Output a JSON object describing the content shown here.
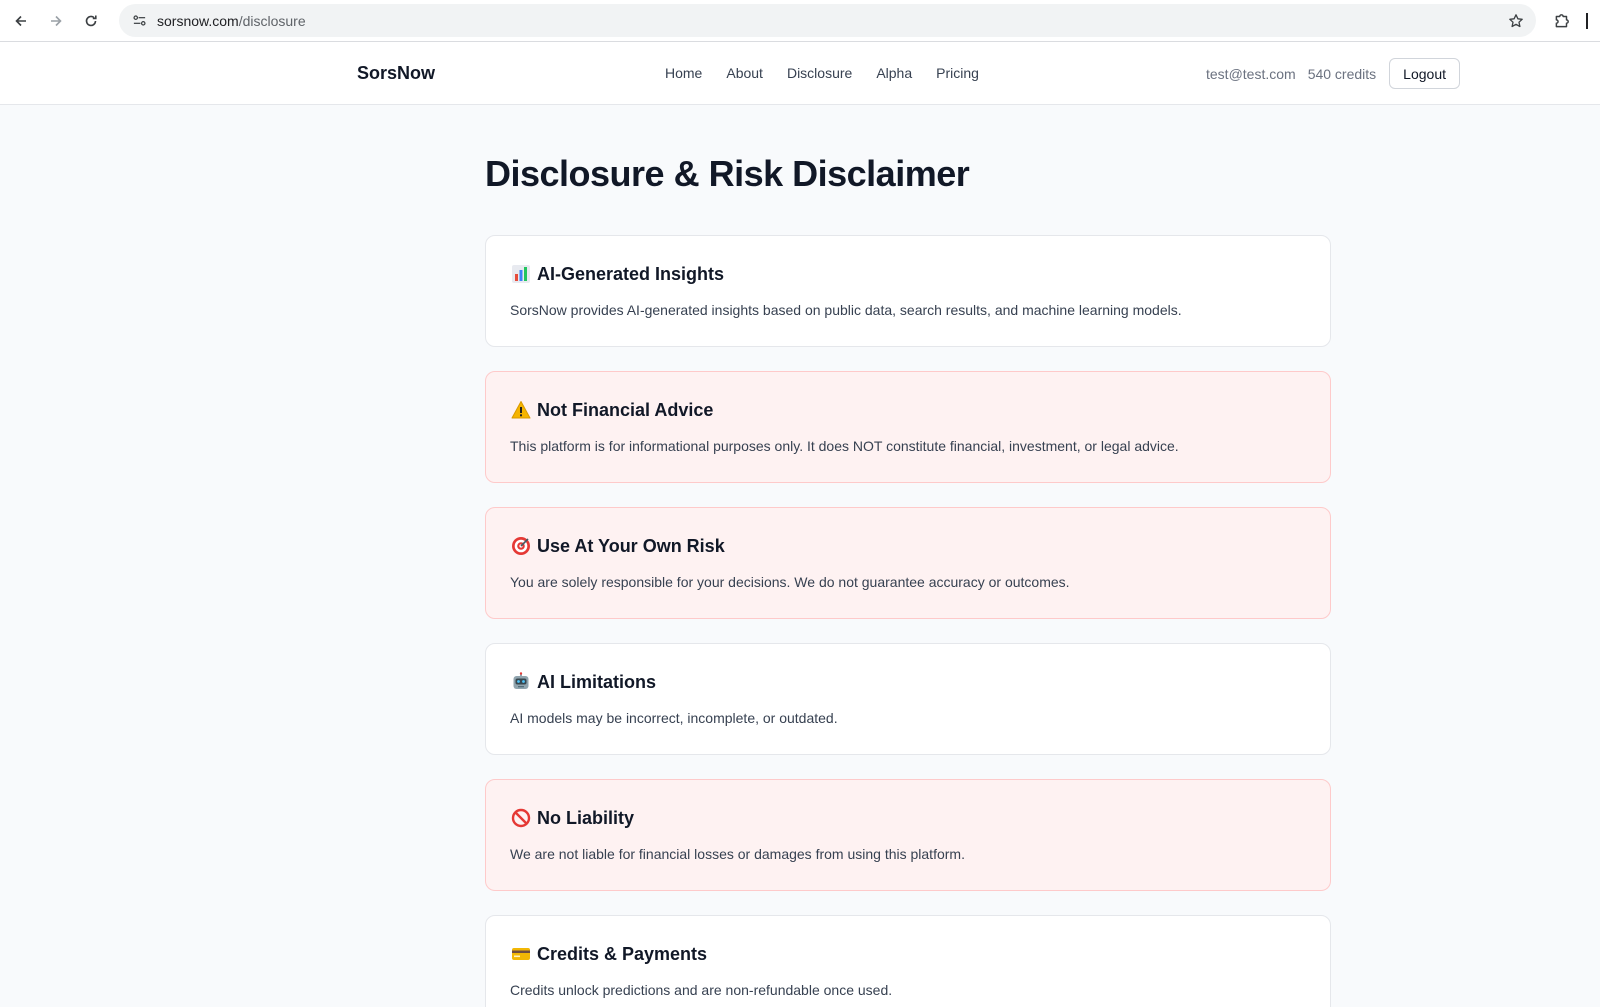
{
  "browser": {
    "url_host": "sorsnow.com",
    "url_path": "/disclosure"
  },
  "nav": {
    "brand": "SorsNow",
    "links": [
      "Home",
      "About",
      "Disclosure",
      "Alpha",
      "Pricing"
    ],
    "user_email": "test@test.com",
    "credits": "540 credits",
    "logout_label": "Logout"
  },
  "page": {
    "title": "Disclosure & Risk Disclaimer"
  },
  "cards": [
    {
      "icon": "bar-chart-icon",
      "title": "AI-Generated Insights",
      "text": "SorsNow provides AI-generated insights based on public data, search results, and machine learning models.",
      "variant": "default"
    },
    {
      "icon": "warning-icon",
      "title": "Not Financial Advice",
      "text": "This platform is for informational purposes only. It does NOT constitute financial, investment, or legal advice.",
      "variant": "warn"
    },
    {
      "icon": "target-icon",
      "title": "Use At Your Own Risk",
      "text": "You are solely responsible for your decisions. We do not guarantee accuracy or outcomes.",
      "variant": "warn"
    },
    {
      "icon": "robot-icon",
      "title": "AI Limitations",
      "text": "AI models may be incorrect, incomplete, or outdated.",
      "variant": "default"
    },
    {
      "icon": "prohibited-icon",
      "title": "No Liability",
      "text": "We are not liable for financial losses or damages from using this platform.",
      "variant": "warn"
    },
    {
      "icon": "credit-card-icon",
      "title": "Credits & Payments",
      "text": "Credits unlock predictions and are non-refundable once used.",
      "variant": "default"
    }
  ],
  "colors": {
    "page_bg": "#f8fafc",
    "card_bg": "#ffffff",
    "warn_bg": "#fef2f2",
    "warn_border": "#fecaca"
  }
}
